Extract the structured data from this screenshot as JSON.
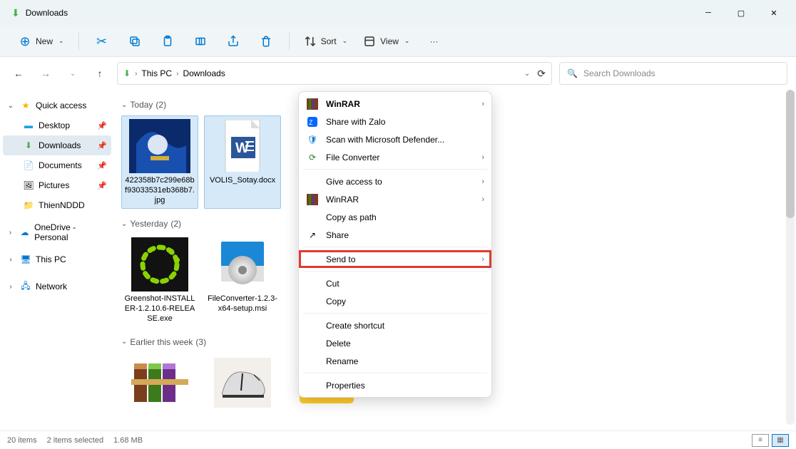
{
  "titlebar": {
    "title": "Downloads"
  },
  "toolbar": {
    "new_label": "New",
    "sort_label": "Sort",
    "view_label": "View"
  },
  "nav": {
    "address": {
      "root": "This PC",
      "folder": "Downloads"
    },
    "search_placeholder": "Search Downloads"
  },
  "sidebar": {
    "quick_access": "Quick access",
    "items": [
      {
        "label": "Desktop"
      },
      {
        "label": "Downloads"
      },
      {
        "label": "Documents"
      },
      {
        "label": "Pictures"
      },
      {
        "label": "ThienNDDD"
      }
    ],
    "onedrive": "OneDrive - Personal",
    "this_pc": "This PC",
    "network": "Network"
  },
  "groups": {
    "today": {
      "label": "Today",
      "count": "(2)"
    },
    "yesterday": {
      "label": "Yesterday",
      "count": "(2)"
    },
    "earlier": {
      "label": "Earlier this week",
      "count": "(3)"
    }
  },
  "files": {
    "today": [
      {
        "name": "422358b7c299e68bf93033531eb368b7.jpg"
      },
      {
        "name": "VOLIS_Sotay.docx"
      }
    ],
    "yesterday": [
      {
        "name": "Greenshot-INSTALLER-1.2.10.6-RELEASE.exe"
      },
      {
        "name": "FileConverter-1.2.3-x64-setup.msi"
      }
    ]
  },
  "context_menu": {
    "winrar": "WinRAR",
    "share_zalo": "Share with Zalo",
    "defender": "Scan with Microsoft Defender...",
    "file_converter": "File Converter",
    "give_access": "Give access to",
    "winrar2": "WinRAR",
    "copy_path": "Copy as path",
    "share": "Share",
    "send_to": "Send to",
    "cut": "Cut",
    "copy": "Copy",
    "create_shortcut": "Create shortcut",
    "delete": "Delete",
    "rename": "Rename",
    "properties": "Properties"
  },
  "status": {
    "count": "20 items",
    "selected": "2 items selected",
    "size": "1.68 MB"
  },
  "colors": {
    "accent": "#0078d4",
    "highlight": "#e03a2f"
  }
}
